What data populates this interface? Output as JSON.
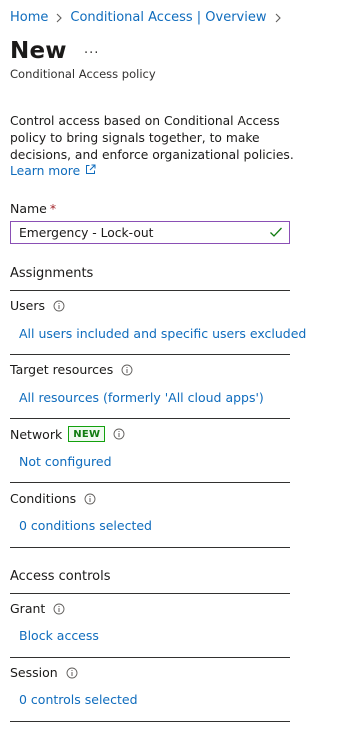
{
  "breadcrumb": {
    "home": "Home",
    "parent": "Conditional Access | Overview"
  },
  "header": {
    "title": "New",
    "more": "...",
    "subtitle": "Conditional Access policy"
  },
  "description": "Control access based on Conditional Access policy to bring signals together, to make decisions, and enforce organizational policies.",
  "learn_more": "Learn more",
  "name_field": {
    "label": "Name",
    "required_marker": "*",
    "value": "Emergency - Lock-out"
  },
  "assignments": {
    "heading": "Assignments",
    "users": {
      "label": "Users",
      "value": "All users included and specific users excluded"
    },
    "target_resources": {
      "label": "Target resources",
      "value": "All resources (formerly 'All cloud apps')"
    },
    "network": {
      "label": "Network",
      "badge": "NEW",
      "value": "Not configured"
    },
    "conditions": {
      "label": "Conditions",
      "value": "0 conditions selected"
    }
  },
  "access_controls": {
    "heading": "Access controls",
    "grant": {
      "label": "Grant",
      "value": "Block access"
    },
    "session": {
      "label": "Session",
      "value": "0 controls selected"
    }
  },
  "icons": {
    "chevron": "chevron-right-icon",
    "external": "external-link-icon",
    "info": "info-icon",
    "check": "checkmark-icon"
  },
  "colors": {
    "link": "#0f6cbd",
    "input_border": "#8a4fb5",
    "check": "#107c10",
    "badge_border": "#13a10e",
    "required": "#a4262c"
  }
}
